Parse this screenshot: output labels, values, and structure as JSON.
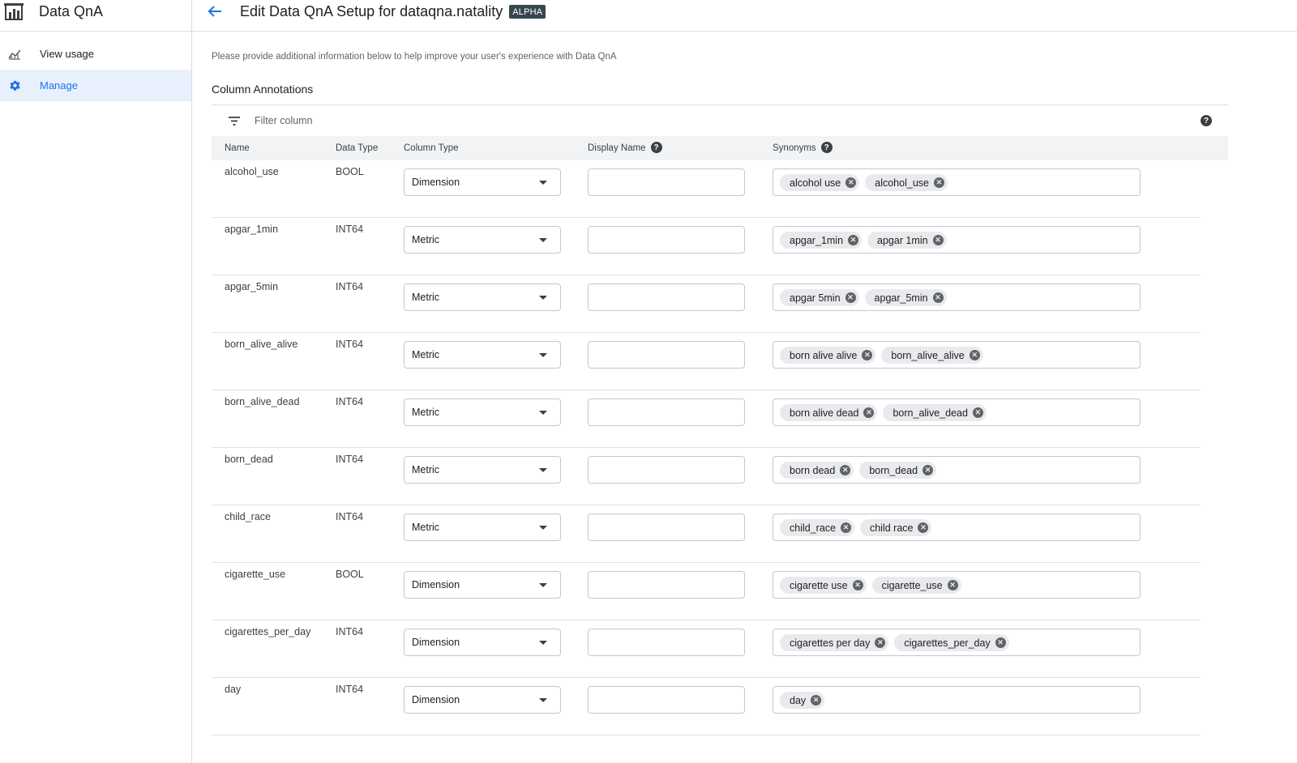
{
  "app": {
    "title": "Data QnA",
    "logo_icon": "building-chart-icon"
  },
  "sidebar": {
    "items": [
      {
        "label": "View usage",
        "icon": "chart-icon",
        "active": false
      },
      {
        "label": "Manage",
        "icon": "gear-icon",
        "active": true
      }
    ]
  },
  "header": {
    "title": "Edit Data QnA Setup for dataqna.natality",
    "badge": "ALPHA",
    "back_icon": "arrow-back-icon"
  },
  "main": {
    "intro": "Please provide additional information below to help improve your user's experience with Data QnA",
    "section_title": "Column Annotations",
    "filter_placeholder": "Filter column",
    "columns": {
      "name": "Name",
      "data_type": "Data Type",
      "column_type": "Column Type",
      "display_name": "Display Name",
      "synonyms": "Synonyms"
    },
    "rows": [
      {
        "name": "alcohol_use",
        "data_type": "BOOL",
        "column_type": "Dimension",
        "display_name": "",
        "synonyms": [
          "alcohol use",
          "alcohol_use"
        ]
      },
      {
        "name": "apgar_1min",
        "data_type": "INT64",
        "column_type": "Metric",
        "display_name": "",
        "synonyms": [
          "apgar_1min",
          "apgar 1min"
        ]
      },
      {
        "name": "apgar_5min",
        "data_type": "INT64",
        "column_type": "Metric",
        "display_name": "",
        "synonyms": [
          "apgar 5min",
          "apgar_5min"
        ]
      },
      {
        "name": "born_alive_alive",
        "data_type": "INT64",
        "column_type": "Metric",
        "display_name": "",
        "synonyms": [
          "born alive alive",
          "born_alive_alive"
        ]
      },
      {
        "name": "born_alive_dead",
        "data_type": "INT64",
        "column_type": "Metric",
        "display_name": "",
        "synonyms": [
          "born alive dead",
          "born_alive_dead"
        ]
      },
      {
        "name": "born_dead",
        "data_type": "INT64",
        "column_type": "Metric",
        "display_name": "",
        "synonyms": [
          "born dead",
          "born_dead"
        ]
      },
      {
        "name": "child_race",
        "data_type": "INT64",
        "column_type": "Metric",
        "display_name": "",
        "synonyms": [
          "child_race",
          "child race"
        ]
      },
      {
        "name": "cigarette_use",
        "data_type": "BOOL",
        "column_type": "Dimension",
        "display_name": "",
        "synonyms": [
          "cigarette use",
          "cigarette_use"
        ]
      },
      {
        "name": "cigarettes_per_day",
        "data_type": "INT64",
        "column_type": "Dimension",
        "display_name": "",
        "synonyms": [
          "cigarettes per day",
          "cigarettes_per_day"
        ]
      },
      {
        "name": "day",
        "data_type": "INT64",
        "column_type": "Dimension",
        "display_name": "",
        "synonyms": [
          "day"
        ]
      }
    ]
  },
  "colors": {
    "accent": "#1a73e8",
    "active_bg": "#e8f0fe",
    "badge_bg": "#37474f",
    "chip_bg": "#e8eaed"
  }
}
